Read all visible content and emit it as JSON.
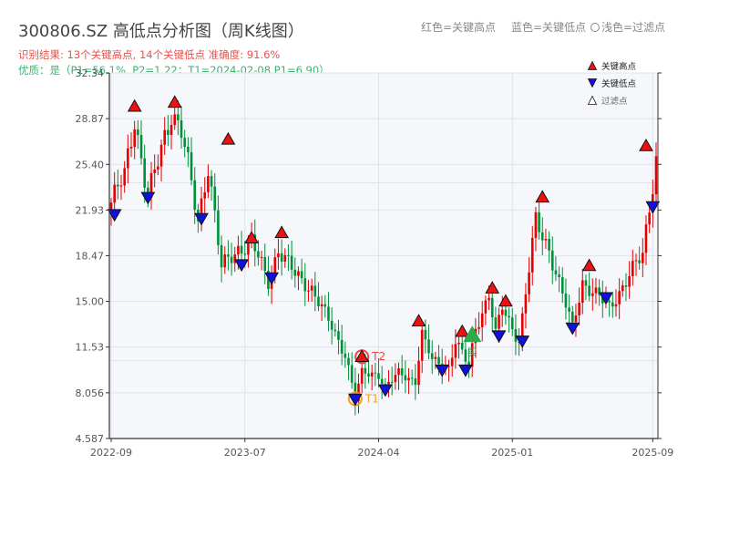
{
  "header": {
    "title": "300806.SZ 高低点分析图（周K线图）",
    "result_line": "识别结果: 13个关键高点, 14个关键低点   准确度: 91.6%",
    "quality_line": "优质：是（P1=56.1%, P2=1.22；T1=2024-02-08 P1=6.90）"
  },
  "top_legend": {
    "red_label": "红色=关键高点",
    "blue_label": "蓝色=关键低点",
    "filtered_label": "浅色=过滤点"
  },
  "colors": {
    "up": "#e60000",
    "down": "#008f3a",
    "high_marker": "#ee1111",
    "low_marker": "#1111dd",
    "grid": "#dde3ea",
    "plot_bg": "#f5f7fa",
    "t1": "#f0a020",
    "t2": "#ee4444",
    "green_marker": "#2eaa4a"
  },
  "chart_data": {
    "type": "candlestick",
    "title": "300806.SZ 高低点分析图（周K线图）",
    "y_ticks": [
      "4.587",
      "8.056",
      "11.53",
      "15.00",
      "18.47",
      "21.93",
      "25.40",
      "28.87",
      "32.34"
    ],
    "y_tick_values": [
      4.587,
      8.056,
      11.53,
      15.0,
      18.47,
      21.93,
      25.4,
      28.87,
      32.34
    ],
    "ylim": [
      4.587,
      32.34
    ],
    "x_ticks": [
      "2022-09",
      "2023-07",
      "2024-04",
      "2025-01",
      "2025-09"
    ],
    "x_tick_index": [
      0,
      40,
      80,
      120,
      162
    ],
    "n_bars": 164,
    "anchors": [
      [
        0,
        22.5
      ],
      [
        4,
        24.5
      ],
      [
        7,
        29.0
      ],
      [
        11,
        22.8
      ],
      [
        15,
        26.5
      ],
      [
        18,
        29.5
      ],
      [
        21,
        28.0
      ],
      [
        26,
        21.0
      ],
      [
        29,
        25.5
      ],
      [
        33,
        17.5
      ],
      [
        38,
        19.0
      ],
      [
        42,
        19.5
      ],
      [
        47,
        16.5
      ],
      [
        50,
        19.0
      ],
      [
        55,
        17.0
      ],
      [
        60,
        16.0
      ],
      [
        65,
        13.5
      ],
      [
        70,
        11.0
      ],
      [
        71,
        10.0
      ],
      [
        73,
        7.6
      ],
      [
        75,
        9.5
      ],
      [
        80,
        9.5
      ],
      [
        82,
        8.5
      ],
      [
        86,
        9.5
      ],
      [
        91,
        9.0
      ],
      [
        93,
        12.5
      ],
      [
        96,
        10.5
      ],
      [
        101,
        10.0
      ],
      [
        103,
        12.0
      ],
      [
        107,
        10.0
      ],
      [
        109,
        13.0
      ],
      [
        113,
        15.5
      ],
      [
        115,
        12.5
      ],
      [
        117,
        14.5
      ],
      [
        122,
        12.0
      ],
      [
        127,
        21.0
      ],
      [
        131,
        19.0
      ],
      [
        135,
        15.5
      ],
      [
        138,
        13.0
      ],
      [
        141,
        16.5
      ],
      [
        145,
        15.5
      ],
      [
        149,
        14.5
      ],
      [
        155,
        17.0
      ],
      [
        159,
        18.5
      ],
      [
        163,
        26.0
      ]
    ],
    "key_highs": [
      {
        "i": 7,
        "price": 29.8
      },
      {
        "i": 19,
        "price": 30.1
      },
      {
        "i": 35,
        "price": 27.3
      },
      {
        "i": 42,
        "price": 19.8
      },
      {
        "i": 51,
        "price": 20.2
      },
      {
        "i": 92,
        "price": 13.5
      },
      {
        "i": 105,
        "price": 12.7
      },
      {
        "i": 114,
        "price": 16.0
      },
      {
        "i": 118,
        "price": 15.0
      },
      {
        "i": 129,
        "price": 22.9
      },
      {
        "i": 143,
        "price": 17.7
      },
      {
        "i": 160,
        "price": 26.8
      }
    ],
    "key_lows": [
      {
        "i": 1,
        "price": 21.6
      },
      {
        "i": 11,
        "price": 22.9
      },
      {
        "i": 27,
        "price": 21.3
      },
      {
        "i": 39,
        "price": 17.8
      },
      {
        "i": 48,
        "price": 16.8
      },
      {
        "i": 82,
        "price": 8.3
      },
      {
        "i": 99,
        "price": 9.8
      },
      {
        "i": 106,
        "price": 9.8
      },
      {
        "i": 116,
        "price": 12.4
      },
      {
        "i": 123,
        "price": 12.0
      },
      {
        "i": 138,
        "price": 13.0
      },
      {
        "i": 148,
        "price": 15.3
      },
      {
        "i": 162,
        "price": 22.2
      }
    ],
    "t1": {
      "i": 73,
      "price": 7.6,
      "label": "T1"
    },
    "t2": {
      "i": 75,
      "price": 10.8,
      "label": "T2"
    },
    "green_marker": {
      "i": 108,
      "price": 12.4,
      "label": "买"
    },
    "legend": {
      "items": [
        {
          "label": "关键高点",
          "symbol": "triangle-up"
        },
        {
          "label": "关键低点",
          "symbol": "triangle-down"
        },
        {
          "label": "过滤点",
          "symbol": "triangle-up-hollow"
        }
      ]
    },
    "grid": true
  }
}
